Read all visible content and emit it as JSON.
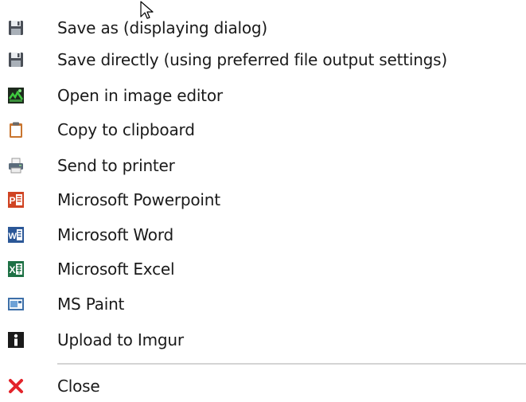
{
  "menu": {
    "items": [
      {
        "label": "Save as (displaying dialog)",
        "icon": "floppy-disk-icon"
      },
      {
        "label": "Save directly (using preferred file output settings)",
        "icon": "floppy-disk-icon"
      },
      {
        "label": "Open in image editor",
        "icon": "image-editor-icon"
      },
      {
        "label": "Copy to clipboard",
        "icon": "clipboard-icon"
      },
      {
        "label": "Send to printer",
        "icon": "printer-icon"
      },
      {
        "label": "Microsoft Powerpoint",
        "icon": "powerpoint-icon"
      },
      {
        "label": "Microsoft Word",
        "icon": "word-icon"
      },
      {
        "label": "Microsoft Excel",
        "icon": "excel-icon"
      },
      {
        "label": "MS Paint",
        "icon": "paint-icon"
      },
      {
        "label": "Upload to Imgur",
        "icon": "imgur-icon"
      },
      {
        "label": "Close",
        "icon": "close-icon"
      }
    ]
  },
  "colors": {
    "powerpoint": "#d04423",
    "word": "#2b5797",
    "excel": "#1e7145",
    "close": "#e3242b",
    "separator": "#d4d4d4"
  }
}
